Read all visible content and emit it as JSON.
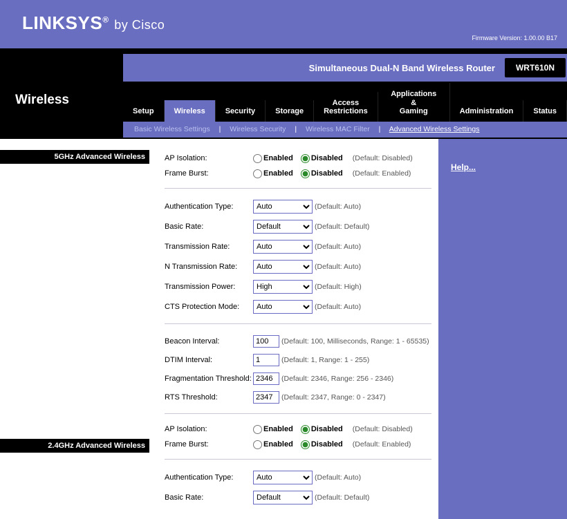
{
  "brand": {
    "name": "LINKSYS",
    "by": "by Cisco",
    "reg": "®"
  },
  "firmware_label": "Firmware Version: 1.00.00 B17",
  "product_name": "Simultaneous Dual-N Band Wireless Router",
  "model": "WRT610N",
  "page_title": "Wireless",
  "tabs": {
    "setup": "Setup",
    "wireless": "Wireless",
    "security": "Security",
    "storage": "Storage",
    "access": "Access\nRestrictions",
    "apps": "Applications &\nGaming",
    "admin": "Administration",
    "status": "Status"
  },
  "subtabs": {
    "basic": "Basic Wireless Settings",
    "sec": "Wireless Security",
    "mac": "Wireless MAC Filter",
    "adv": "Advanced Wireless Settings",
    "sep": "|"
  },
  "sections": {
    "ghz5": "5GHz Advanced Wireless",
    "ghz24": "2.4GHz Advanced Wireless"
  },
  "help": "Help...",
  "labels": {
    "ap_isolation": "AP Isolation:",
    "frame_burst": "Frame Burst:",
    "auth_type": "Authentication Type:",
    "basic_rate": "Basic Rate:",
    "tx_rate": "Transmission Rate:",
    "n_tx_rate": "N Transmission Rate:",
    "tx_power": "Transmission Power:",
    "cts_mode": "CTS Protection Mode:",
    "beacon": "Beacon Interval:",
    "dtim": "DTIM Interval:",
    "frag": "Fragmentation Threshold:",
    "rts": "RTS Threshold:"
  },
  "radio": {
    "enabled": "Enabled",
    "disabled": "Disabled"
  },
  "defaults": {
    "disabled": "(Default: Disabled)",
    "enabled": "(Default: Enabled)",
    "auto": "(Default: Auto)",
    "default": "(Default: Default)",
    "high": "(Default: High)",
    "beacon": "(Default: 100, Milliseconds, Range: 1 - 65535)",
    "dtim": "(Default: 1, Range: 1 - 255)",
    "frag": "(Default: 2346, Range: 256 - 2346)",
    "rts": "(Default: 2347, Range: 0 - 2347)"
  },
  "select_values": {
    "auth_type": "Auto",
    "basic_rate": "Default",
    "tx_rate": "Auto",
    "n_tx_rate": "Auto",
    "tx_power": "High",
    "cts_mode": "Auto",
    "auth_type_24": "Auto",
    "basic_rate_24": "Default"
  },
  "input_values": {
    "beacon": "100",
    "dtim": "1",
    "frag": "2346",
    "rts": "2347"
  }
}
